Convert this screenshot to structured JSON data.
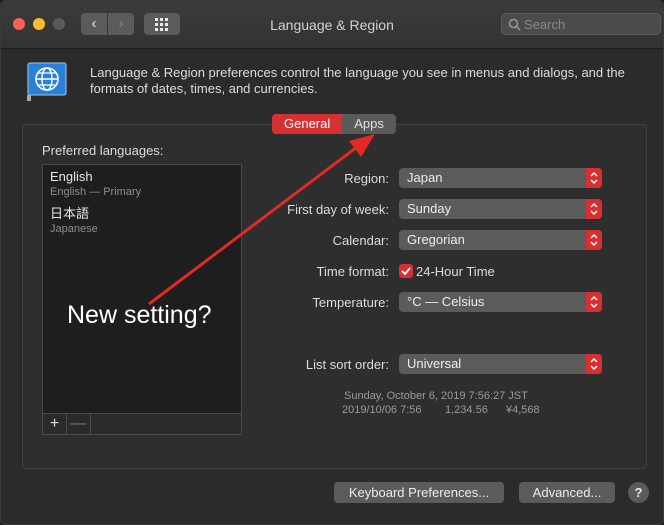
{
  "window": {
    "title": "Language & Region"
  },
  "toolbar": {
    "back_icon": "chevron-left",
    "forward_icon": "chevron-right",
    "grid_icon": "show-all-grid"
  },
  "search": {
    "placeholder": "Search"
  },
  "header": {
    "description": "Language & Region preferences control the language you see in menus and dialogs, and the formats of dates, times, and currencies."
  },
  "tabs": [
    {
      "label": "General",
      "active": true
    },
    {
      "label": "Apps",
      "active": false
    }
  ],
  "preferred": {
    "label": "Preferred languages:",
    "languages": [
      {
        "name": "English",
        "sub": "English — Primary"
      },
      {
        "name": "日本語",
        "sub": "Japanese"
      }
    ],
    "add_label": "+",
    "remove_label": "—"
  },
  "settings": {
    "region": {
      "label": "Region:",
      "value": "Japan"
    },
    "first_day": {
      "label": "First day of week:",
      "value": "Sunday"
    },
    "calendar": {
      "label": "Calendar:",
      "value": "Gregorian"
    },
    "time_format": {
      "label": "Time format:",
      "checkbox_label": "24-Hour Time",
      "checked": true
    },
    "temperature": {
      "label": "Temperature:",
      "value": "°C — Celsius"
    },
    "sort_order": {
      "label": "List sort order:",
      "value": "Universal"
    }
  },
  "sample": {
    "line1": "Sunday, October 6, 2019 7:56:27 JST",
    "date": "2019/10/06 7:56",
    "number": "1,234.56",
    "currency": "¥4,568"
  },
  "buttons": {
    "keyboard": "Keyboard Preferences...",
    "advanced": "Advanced...",
    "help": "?"
  },
  "annotation": {
    "text": "New setting?",
    "color": "#e02a22"
  },
  "colors": {
    "accent": "#d73032"
  }
}
